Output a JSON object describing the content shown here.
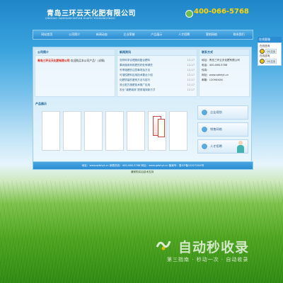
{
  "header": {
    "company_cn": "青岛三环云天化肥有限公司",
    "company_en": "QINGDAO SANHUANYUNTIAN HUAFEI YOUXIANGONGSI",
    "phone": "400-066-5768"
  },
  "nav": {
    "items": [
      "网站首页",
      "公司简介",
      "新闻动态",
      "企业荣誉",
      "产品展示",
      "人才招聘",
      "营销网络",
      "联系我们"
    ]
  },
  "side": {
    "title": "在线客服",
    "rows": [
      {
        "label": "在线咨询",
        "btn": ""
      },
      {
        "label": "",
        "btn": "QQ交谈"
      },
      {
        "label": "在线咨询",
        "btn": ""
      },
      {
        "label": "",
        "btn": "QQ交谈"
      }
    ]
  },
  "about": {
    "title": "公司简介",
    "name": "青岛三环云天化肥有限公司",
    "text": "欢迎购买本公司产品！(详情)"
  },
  "news": {
    "title": "新闻资讯",
    "items": [
      {
        "text": "怎样科学合理施用复合肥料",
        "date": "12-17"
      },
      {
        "text": "果树施用有机肥的好处有哪些",
        "date": "12-17"
      },
      {
        "text": "冬季施肥的注意事项及方法",
        "date": "12-17"
      },
      {
        "text": "可溶性肥料应用技术要点介绍",
        "date": "12-17"
      },
      {
        "text": "化肥质量的鉴别方法与技巧",
        "date": "12-17"
      },
      {
        "text": "测土配方施肥技术推广应用",
        "date": "12-17"
      },
      {
        "text": "农业“减肥增效”提质增效新方式",
        "date": "12-17"
      }
    ]
  },
  "contact": {
    "title": "联系方式",
    "lines": [
      "地址：青岛三环云天化肥有限公司",
      "电话：400-066-5768",
      "传真：",
      "网址：www.qdshyt.cn",
      "邮箱：1209XXXX"
    ]
  },
  "products": {
    "title": "产品展示"
  },
  "services": [
    {
      "label": "企业规划"
    },
    {
      "label": "销售网络"
    },
    {
      "label": "人才招聘"
    }
  ],
  "footer": {
    "line1": "地址：www.qdshyt.cn   销售热线：400-066-5768   网址：www.qdshyt.cn   备案号：鲁ICP备12027XXX号",
    "line2": "通常购买后技术支持"
  },
  "watermark": {
    "title": "自动秒收录",
    "sub": "第三指南 · 秒动一次 · 自动收录"
  },
  "colors": {
    "accent": "#2b8cd2",
    "phone": "#ffd400"
  }
}
